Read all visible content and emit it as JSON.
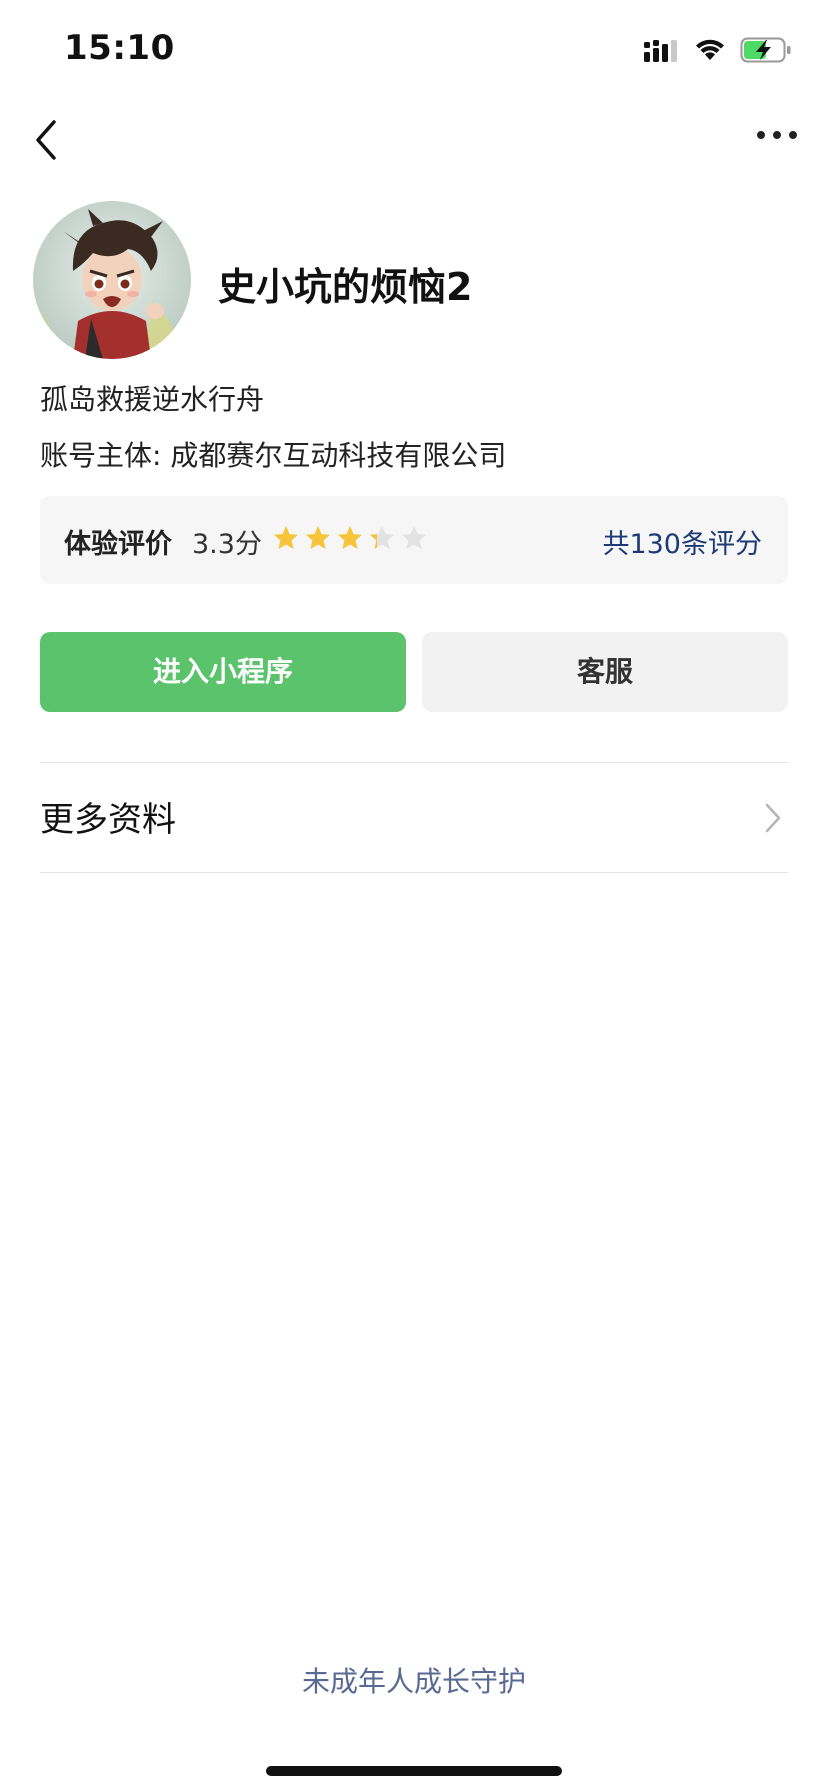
{
  "status_bar": {
    "time": "15:10",
    "icons": [
      "signal-icon",
      "wifi-icon",
      "battery-charging-icon"
    ]
  },
  "nav": {
    "back_icon": "chevron-left-icon",
    "more_icon": "more-dots-icon"
  },
  "profile": {
    "avatar_icon": "cartoon-boy-avatar",
    "name": "史小坑的烦恼2",
    "description": "孤岛救援逆水行舟",
    "account_entity": "账号主体: 成都赛尔互动科技有限公司"
  },
  "rating": {
    "label": "体验评价",
    "score_text": "3.3分",
    "score": 3.3,
    "max": 5,
    "count_text": "共130条评分",
    "star_color": "#f7c43a",
    "empty_star_color": "#e3e3e3"
  },
  "actions": {
    "enter_label": "进入小程序",
    "service_label": "客服",
    "enter_color": "#5ac36c"
  },
  "more_info": {
    "label": "更多资料"
  },
  "footer": {
    "link": "未成年人成长守护"
  }
}
